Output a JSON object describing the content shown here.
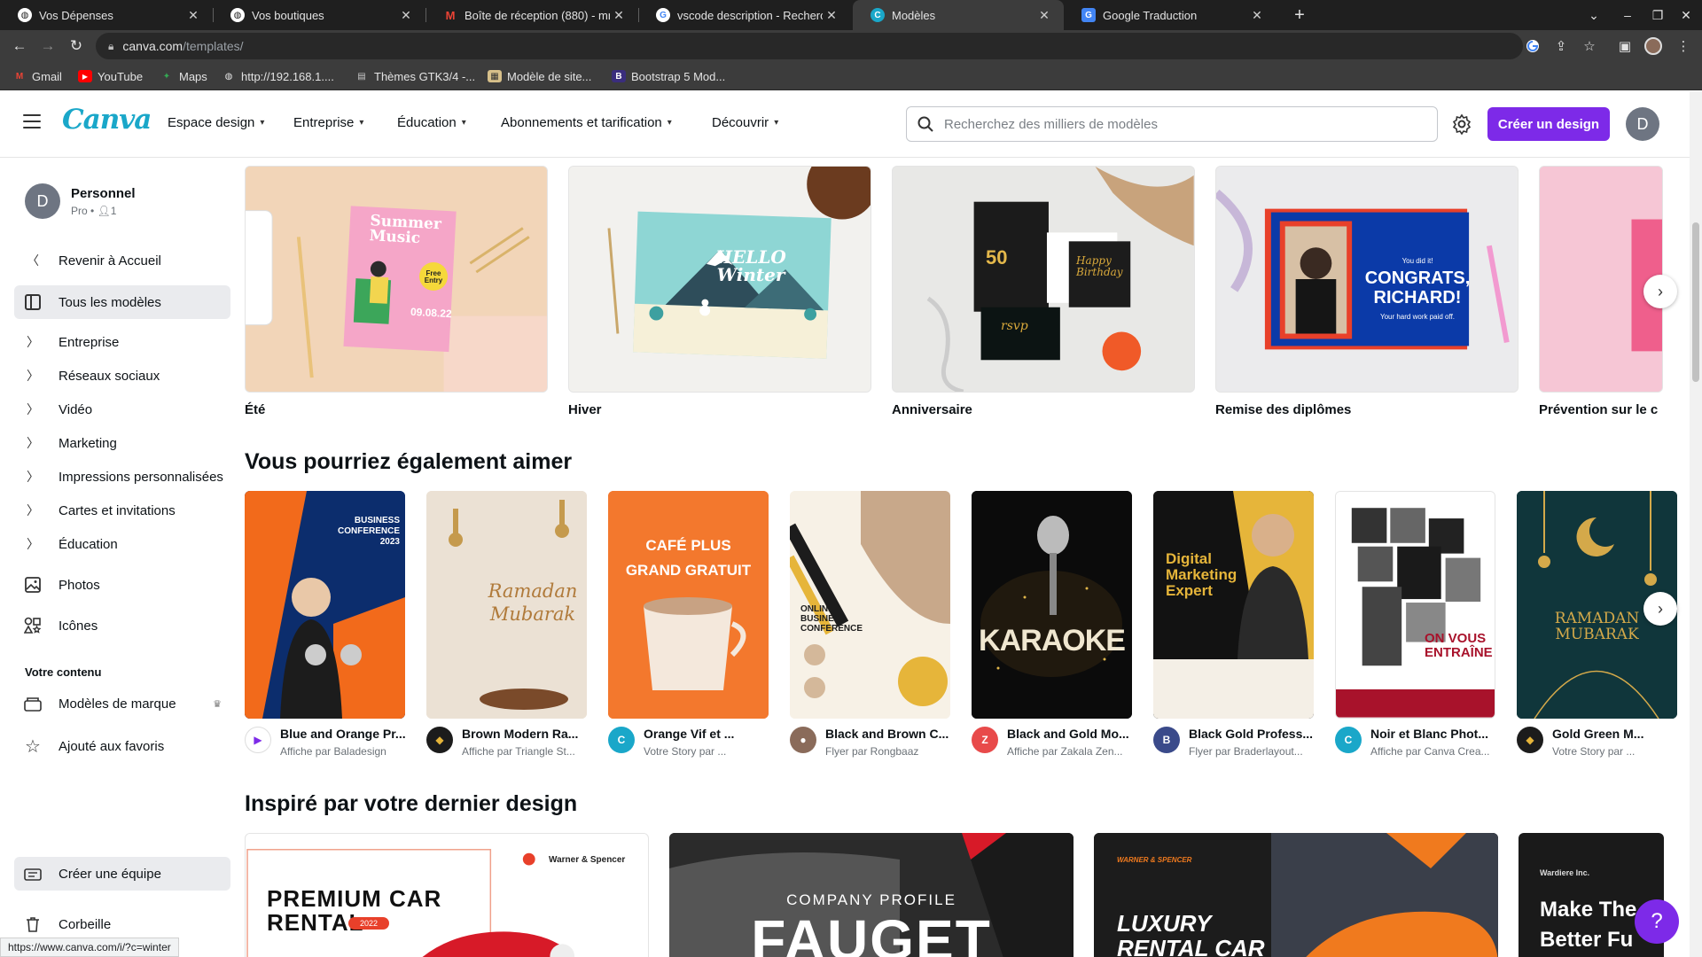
{
  "browser": {
    "tabs": [
      {
        "title": "Vos Dépenses",
        "icon": "globe-icon"
      },
      {
        "title": "Vos boutiques",
        "icon": "globe-icon"
      },
      {
        "title": "Boîte de réception (880) - mm",
        "icon": "gmail-icon"
      },
      {
        "title": "vscode description - Recherch",
        "icon": "google-icon"
      },
      {
        "title": "Modèles",
        "icon": "canva-icon"
      },
      {
        "title": "Google Traduction",
        "icon": "translate-icon"
      }
    ],
    "url_host": "canva.com",
    "url_path": "/templates/",
    "bookmarks": [
      {
        "label": "Gmail",
        "icon": "gmail-icon"
      },
      {
        "label": "YouTube",
        "icon": "youtube-icon"
      },
      {
        "label": "Maps",
        "icon": "maps-icon"
      },
      {
        "label": "http://192.168.1....",
        "icon": "globe-icon"
      },
      {
        "label": "Thèmes GTK3/4 -...",
        "icon": "folder-icon"
      },
      {
        "label": "Modèle de site...",
        "icon": "image-icon"
      },
      {
        "label": "Bootstrap 5 Mod...",
        "icon": "bootstrap-icon"
      }
    ],
    "status_url": "https://www.canva.com/i/?c=winter"
  },
  "header": {
    "logo": "Canva",
    "nav": [
      "Espace design",
      "Entreprise",
      "Éducation",
      "Abonnements et tarification",
      "Découvrir"
    ],
    "search_placeholder": "Recherchez des milliers de modèles",
    "create_label": "Créer un design",
    "avatar_letter": "D"
  },
  "sidebar": {
    "account_name": "Personnel",
    "account_sub": "Pro • ",
    "account_members": "1",
    "avatar_letter": "D",
    "back_label": "Revenir à Accueil",
    "all_templates": "Tous les modèles",
    "categories": [
      "Entreprise",
      "Réseaux sociaux",
      "Vidéo",
      "Marketing",
      "Impressions personnalisées",
      "Cartes et invitations",
      "Éducation"
    ],
    "photos": "Photos",
    "icons": "Icônes",
    "your_content": "Votre contenu",
    "brand_templates": "Modèles de marque",
    "favorites": "Ajouté aux favoris",
    "create_team": "Créer une équipe",
    "trash": "Corbeille"
  },
  "main": {
    "seasonal": [
      {
        "label": "Été"
      },
      {
        "label": "Hiver"
      },
      {
        "label": "Anniversaire"
      },
      {
        "label": "Remise des diplômes"
      },
      {
        "label": "Prévention sur le ca"
      }
    ],
    "seasonal_card_text": {
      "summer_title": "Summer Music",
      "summer_badge": "Free Entry",
      "summer_date": "09.08.22",
      "winter_text": "HELLO Winter",
      "anniv_number": "50",
      "anniv_text": "Happy Birthday",
      "anniv_rsvp": "rsvp",
      "grad_small": "You did it!",
      "grad_title": "CONGRATS, RICHARD!",
      "grad_sub": "Your hard work paid off."
    },
    "section2_title": "Vous pourriez également aimer",
    "templates": [
      {
        "title": "Blue and Orange Pr...",
        "sub": "Affiche par Baladesign",
        "thumb_text": "BUSINESS CONFERENCE 2023"
      },
      {
        "title": "Brown Modern Ra...",
        "sub": "Affiche par Triangle St...",
        "thumb_text": "Ramadan Mubarak"
      },
      {
        "title": "Orange Vif et ...",
        "sub": "Votre Story par ...",
        "thumb_text": "CAFÉ PLUS GRAND GRATUIT"
      },
      {
        "title": "Black and Brown C...",
        "sub": "Flyer par Rongbaaz",
        "thumb_text": "ONLINE BUSINESS CONFERENCE"
      },
      {
        "title": "Black and Gold Mo...",
        "sub": "Affiche par Zakala Zen...",
        "thumb_text": "KARAOKE"
      },
      {
        "title": "Black Gold Profess...",
        "sub": "Flyer par Braderlayout...",
        "thumb_text": "Digital Marketing Expert"
      },
      {
        "title": "Noir et Blanc Phot...",
        "sub": "Affiche par Canva Crea...",
        "thumb_text": "ON VOUS ENTRAÎNE"
      },
      {
        "title": "Gold Green M...",
        "sub": "Votre Story par ...",
        "thumb_text": "RAMADAN MUBARAK"
      }
    ],
    "section3_title": "Inspiré par votre dernier design",
    "recent": [
      {
        "brand": "Warner & Spencer",
        "text": "PREMIUM CAR RENTAL",
        "badge": "2022"
      },
      {
        "brand": "",
        "text": "FAUGET",
        "sub": "COMPANY PROFILE"
      },
      {
        "brand": "WARNER & SPENCER",
        "text": "LUXURY RENTAL CAR"
      },
      {
        "brand": "Wardiere Inc.",
        "text": "Make The A Better Fu"
      }
    ]
  },
  "colors": {
    "accent": "#7d2ae8",
    "logo": "#1aa7c9"
  }
}
